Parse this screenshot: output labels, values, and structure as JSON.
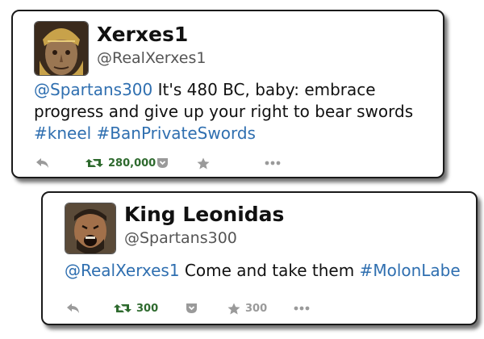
{
  "tweets": [
    {
      "name": "Xerxes1",
      "handle": "@RealXerxes1",
      "text": {
        "line1_mention": "@Spartans300",
        "line1_rest": " It's 480 BC, baby: embrace",
        "line2": "progress and give up your right to bear swords",
        "line3_tag1": "#kneel",
        "line3_tag2": "#BanPrivateSwords"
      },
      "retweets": "280,000",
      "favorites": ""
    },
    {
      "name": "King Leonidas",
      "handle": "@Spartans300",
      "text": {
        "mention": "@RealXerxes1",
        "body": " Come and take them ",
        "tag": "#MolonLabe"
      },
      "retweets": "300",
      "favorites": "300"
    }
  ],
  "colors": {
    "link": "#2f6fb0",
    "retweet": "#2e6a2e",
    "icon_gray": "#9a9a9a"
  },
  "icons": [
    "reply-icon",
    "retweet-icon",
    "favorite-icon",
    "pocket-icon",
    "more-icon"
  ]
}
